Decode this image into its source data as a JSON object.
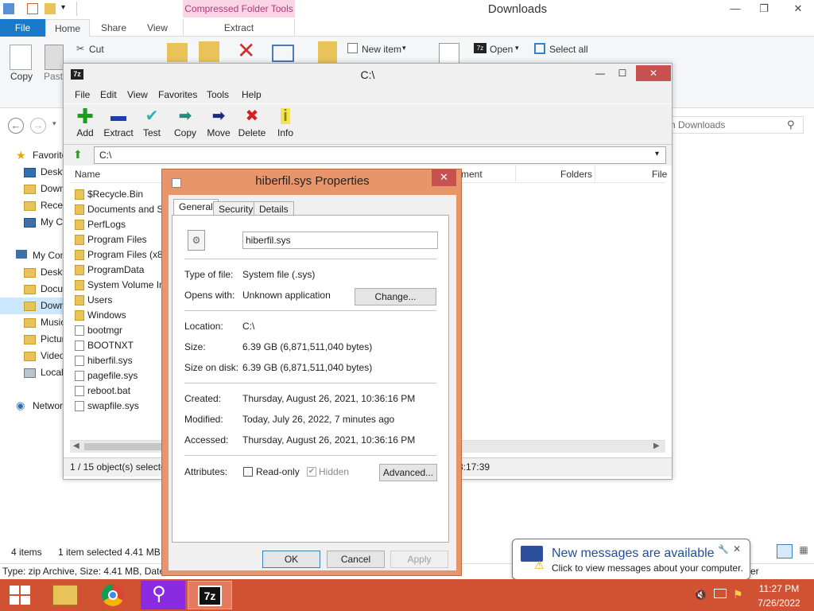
{
  "explorer": {
    "title": "Downloads",
    "context_tab": "Compressed Folder Tools",
    "tabs": [
      "File",
      "Home",
      "Share",
      "View",
      "Extract"
    ],
    "ribbon": {
      "copy": "Copy",
      "paste": "Paste",
      "cut": "Cut",
      "new_item": "New item",
      "open": "Open",
      "select_all": "Select all"
    },
    "search_placeholder": "h Downloads",
    "nav": {
      "favorites": "Favorites",
      "desktop": "Desktop",
      "downloads": "Downloads",
      "recent": "Recent places",
      "mycomp_short": "My C",
      "my_computer": "My Computer",
      "desktop2": "Desktop",
      "documents": "Documents",
      "downloads2": "Downloads",
      "music": "Music",
      "pictures": "Pictures",
      "videos": "Videos",
      "local": "Local Disk",
      "network": "Network"
    },
    "status_items": "4 items",
    "status_selected": "1 item selected  4.41 MB",
    "type_bar": "Type: zip Archive, Size: 4.41 MB, Date m",
    "type_bar_right": "er"
  },
  "sevenzip": {
    "title": "C:\\",
    "menu": [
      "File",
      "Edit",
      "View",
      "Favorites",
      "Tools",
      "Help"
    ],
    "toolbar": [
      "Add",
      "Extract",
      "Test",
      "Copy",
      "Move",
      "Delete",
      "Info"
    ],
    "address": "C:\\",
    "columns": [
      "Name",
      "ment",
      "Folders",
      "File"
    ],
    "files": [
      {
        "name": "$Recycle.Bin",
        "type": "folder"
      },
      {
        "name": "Documents and S",
        "type": "folder"
      },
      {
        "name": "PerfLogs",
        "type": "folder"
      },
      {
        "name": "Program Files",
        "type": "folder"
      },
      {
        "name": "Program Files (x86",
        "type": "folder"
      },
      {
        "name": "ProgramData",
        "type": "folder"
      },
      {
        "name": "System Volume In",
        "type": "folder"
      },
      {
        "name": "Users",
        "type": "folder"
      },
      {
        "name": "Windows",
        "type": "folder"
      },
      {
        "name": "bootmgr",
        "type": "file"
      },
      {
        "name": "BOOTNXT",
        "type": "file"
      },
      {
        "name": "hiberfil.sys",
        "type": "file"
      },
      {
        "name": "pagefile.sys",
        "type": "file"
      },
      {
        "name": "reboot.bat",
        "type": "file"
      },
      {
        "name": "swapfile.sys",
        "type": "file"
      }
    ],
    "status_left": "1 / 15 object(s) selecte",
    "status_right": "3:17:39"
  },
  "props": {
    "title": "hiberfil.sys Properties",
    "tabs": [
      "General",
      "Security",
      "Details"
    ],
    "filename": "hiberfil.sys",
    "type_label": "Type of file:",
    "type_value": "System file (.sys)",
    "opens_label": "Opens with:",
    "opens_value": "Unknown application",
    "change_btn": "Change...",
    "location_label": "Location:",
    "location_value": "C:\\",
    "size_label": "Size:",
    "size_value": "6.39 GB (6,871,511,040 bytes)",
    "sod_label": "Size on disk:",
    "sod_value": "6.39 GB (6,871,511,040 bytes)",
    "created_label": "Created:",
    "created_value": "Thursday, August 26, 2021, 10:36:16 PM",
    "modified_label": "Modified:",
    "modified_value": "Today, July 26, 2022, 7 minutes ago",
    "accessed_label": "Accessed:",
    "accessed_value": "Thursday, August 26, 2021, 10:36:16 PM",
    "attributes_label": "Attributes:",
    "readonly_label": "Read-only",
    "hidden_label": "Hidden",
    "advanced_btn": "Advanced...",
    "ok": "OK",
    "cancel": "Cancel",
    "apply": "Apply"
  },
  "notification": {
    "title": "New messages are available",
    "text": "Click to view messages about your computer."
  },
  "taskbar": {
    "time": "11:27 PM",
    "date": "7/26/2022"
  }
}
